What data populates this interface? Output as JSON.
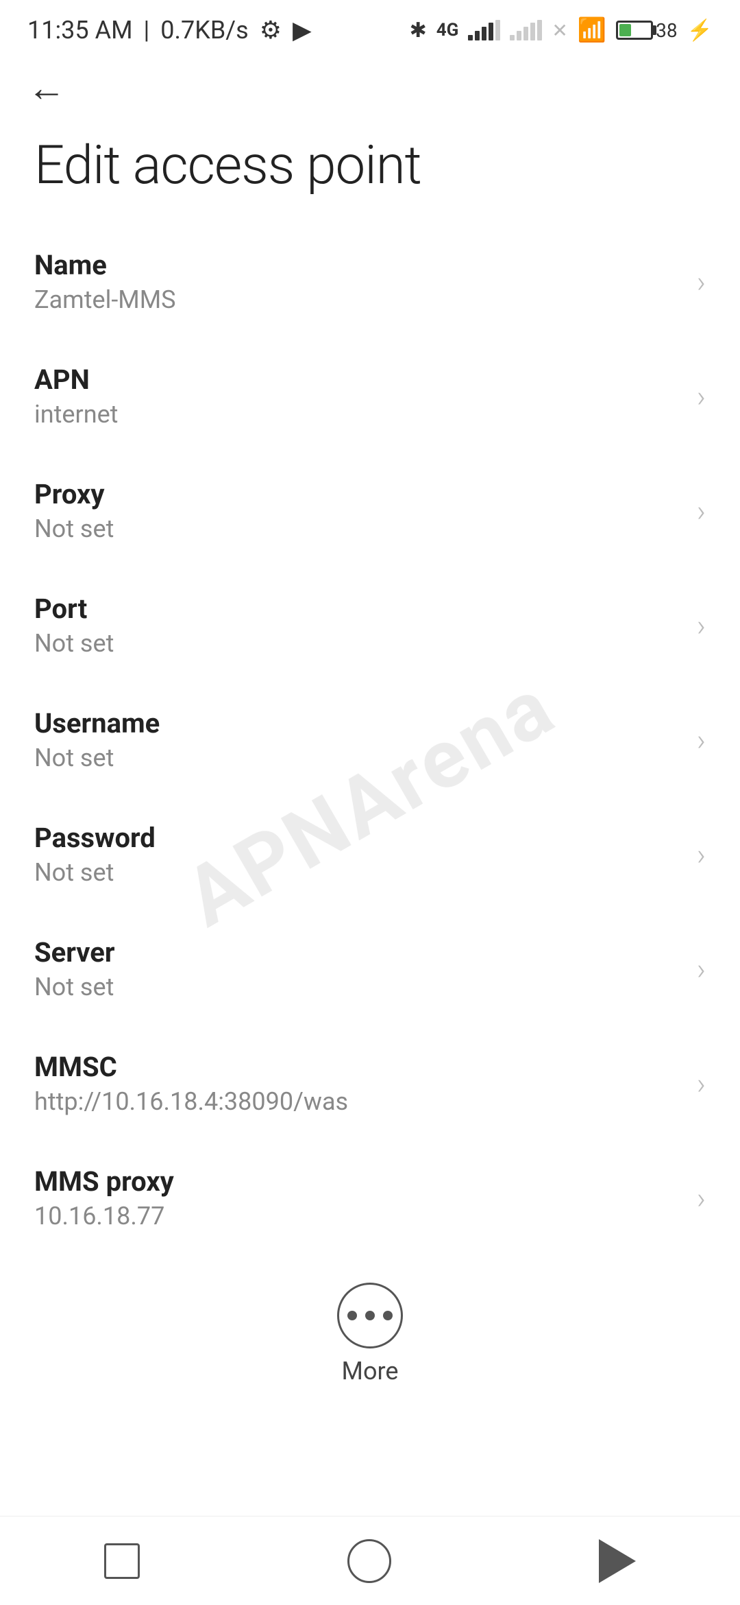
{
  "statusBar": {
    "time": "11:35 AM",
    "speed": "0.7KB/s"
  },
  "header": {
    "backLabel": "←",
    "title": "Edit access point"
  },
  "settings": [
    {
      "label": "Name",
      "value": "Zamtel-MMS"
    },
    {
      "label": "APN",
      "value": "internet"
    },
    {
      "label": "Proxy",
      "value": "Not set"
    },
    {
      "label": "Port",
      "value": "Not set"
    },
    {
      "label": "Username",
      "value": "Not set"
    },
    {
      "label": "Password",
      "value": "Not set"
    },
    {
      "label": "Server",
      "value": "Not set"
    },
    {
      "label": "MMSC",
      "value": "http://10.16.18.4:38090/was"
    },
    {
      "label": "MMS proxy",
      "value": "10.16.18.77"
    }
  ],
  "more": {
    "label": "More"
  },
  "watermark": "APNArena"
}
